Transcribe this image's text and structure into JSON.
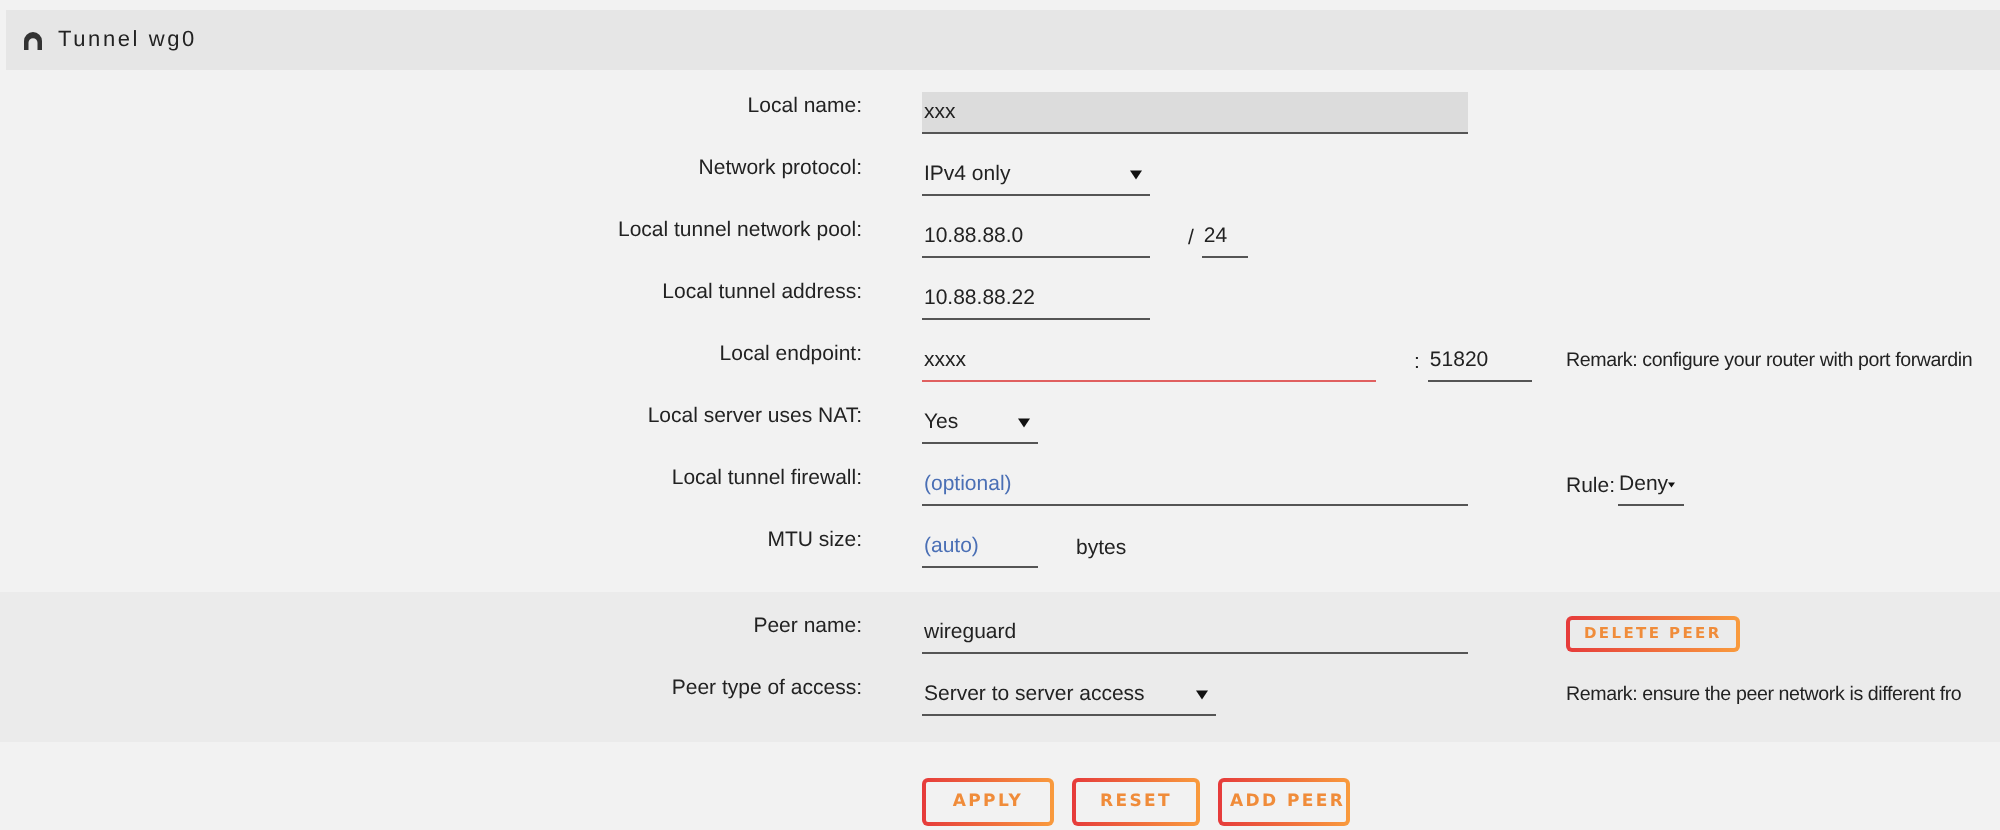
{
  "header": {
    "title": "Tunnel wg0"
  },
  "sections": [
    {
      "kind": "local",
      "rows": [
        {
          "label": "Local name:",
          "fields": [
            {
              "kind": "input",
              "value": "xxx",
              "focused": true,
              "invalid": false
            }
          ]
        },
        {
          "label": "Network protocol:",
          "fields": [
            {
              "kind": "select",
              "value": "IPv4 only"
            }
          ]
        },
        {
          "label": "Local tunnel network pool:",
          "fields": [
            {
              "kind": "input",
              "value": "10.88.88.0",
              "focused": false,
              "invalid": false
            },
            {
              "kind": "text",
              "text": "/"
            },
            {
              "kind": "input",
              "value": "24",
              "focused": false,
              "invalid": false
            }
          ]
        },
        {
          "label": "Local tunnel address:",
          "fields": [
            {
              "kind": "input",
              "value": "10.88.88.22",
              "focused": false,
              "invalid": false
            }
          ]
        },
        {
          "label": "Local endpoint:",
          "fields": [
            {
              "kind": "input",
              "value": "xxxx",
              "focused": false,
              "invalid": true
            },
            {
              "kind": "text",
              "text": ":"
            },
            {
              "kind": "input",
              "value": "51820",
              "focused": false,
              "invalid": false
            }
          ],
          "extra": {
            "kind": "remark",
            "text": "Remark: configure your router with port forwardin"
          }
        },
        {
          "label": "Local server uses NAT:",
          "fields": [
            {
              "kind": "select",
              "value": "Yes"
            }
          ]
        },
        {
          "label": "Local tunnel firewall:",
          "fields": [
            {
              "kind": "input",
              "placeholder": "(optional)",
              "focused": false,
              "invalid": false
            }
          ],
          "extra": {
            "kind": "rule",
            "label": "Rule:",
            "value": "Deny"
          }
        },
        {
          "label": "MTU size:",
          "fields": [
            {
              "kind": "input",
              "placeholder": "(auto)",
              "focused": false,
              "invalid": false
            },
            {
              "kind": "text",
              "text": "bytes"
            }
          ]
        }
      ]
    },
    {
      "kind": "peer",
      "rows": [
        {
          "label": "Peer name:",
          "fields": [
            {
              "kind": "input",
              "value": "wireguard",
              "focused": false,
              "invalid": false
            }
          ],
          "extra": {
            "kind": "button",
            "label": "DELETE PEER"
          }
        },
        {
          "label": "Peer type of access:",
          "fields": [
            {
              "kind": "select",
              "value": "Server to server access"
            }
          ],
          "extra": {
            "kind": "remark",
            "text": "Remark: ensure the peer network is different fro"
          }
        }
      ]
    }
  ],
  "buttons": [
    {
      "label": "APPLY"
    },
    {
      "label": "RESET"
    },
    {
      "label": "ADD PEER"
    }
  ]
}
